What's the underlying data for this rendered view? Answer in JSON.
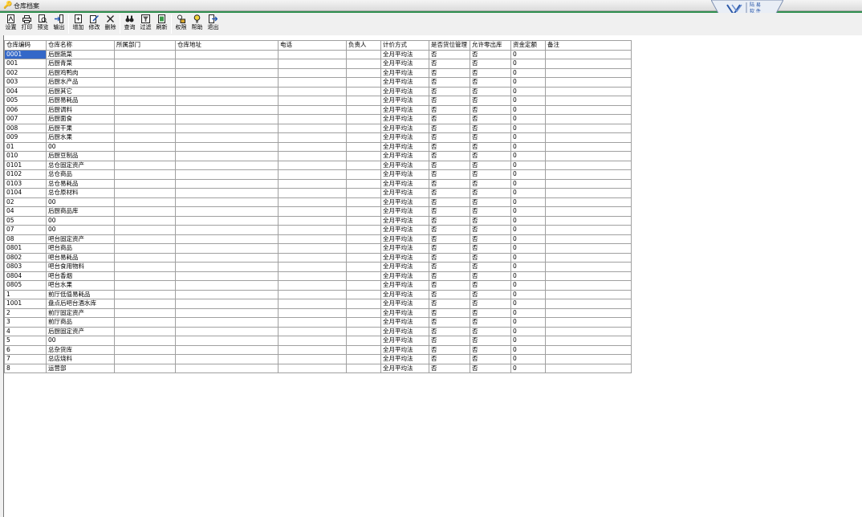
{
  "window": {
    "title": "仓库档案"
  },
  "logo": {
    "line1": "陆 易",
    "line2": "软 件"
  },
  "toolbar": [
    {
      "name": "settings",
      "label": "设置",
      "icon": "settings-icon"
    },
    {
      "name": "print",
      "label": "打印",
      "icon": "print-icon"
    },
    {
      "name": "preview",
      "label": "预览",
      "icon": "preview-icon"
    },
    {
      "name": "export",
      "label": "输出",
      "icon": "export-icon"
    },
    {
      "name": "add",
      "label": "增加",
      "icon": "add-icon"
    },
    {
      "name": "edit",
      "label": "修改",
      "icon": "edit-icon"
    },
    {
      "name": "delete",
      "label": "删除",
      "icon": "delete-icon"
    },
    {
      "name": "query",
      "label": "查询",
      "icon": "binoculars-icon"
    },
    {
      "name": "filter",
      "label": "过滤",
      "icon": "filter-icon"
    },
    {
      "name": "refresh",
      "label": "刷新",
      "icon": "refresh-icon"
    },
    {
      "name": "permission",
      "label": "权限",
      "icon": "permission-icon"
    },
    {
      "name": "help",
      "label": "帮助",
      "icon": "help-icon"
    },
    {
      "name": "exit",
      "label": "退出",
      "icon": "exit-icon"
    }
  ],
  "table": {
    "columns": [
      "仓库编码",
      "仓库名称",
      "所属部门",
      "仓库地址",
      "电话",
      "负责人",
      "计价方式",
      "是否货位管理",
      "允许零出库",
      "资金定额",
      "备注"
    ],
    "rows": [
      [
        "0001",
        "后厨蔬菜",
        "",
        "",
        "",
        "",
        "全月平均法",
        "否",
        "否",
        "0",
        ""
      ],
      [
        "001",
        "后厨青菜",
        "",
        "",
        "",
        "",
        "全月平均法",
        "否",
        "否",
        "0",
        ""
      ],
      [
        "002",
        "后厨鸡鸭肉",
        "",
        "",
        "",
        "",
        "全月平均法",
        "否",
        "否",
        "0",
        ""
      ],
      [
        "003",
        "后厨水产品",
        "",
        "",
        "",
        "",
        "全月平均法",
        "否",
        "否",
        "0",
        ""
      ],
      [
        "004",
        "后厨其它",
        "",
        "",
        "",
        "",
        "全月平均法",
        "否",
        "否",
        "0",
        ""
      ],
      [
        "005",
        "后厨易耗品",
        "",
        "",
        "",
        "",
        "全月平均法",
        "否",
        "否",
        "0",
        ""
      ],
      [
        "006",
        "后厨调料",
        "",
        "",
        "",
        "",
        "全月平均法",
        "否",
        "否",
        "0",
        ""
      ],
      [
        "007",
        "后厨面食",
        "",
        "",
        "",
        "",
        "全月平均法",
        "否",
        "否",
        "0",
        ""
      ],
      [
        "008",
        "后厨干果",
        "",
        "",
        "",
        "",
        "全月平均法",
        "否",
        "否",
        "0",
        ""
      ],
      [
        "009",
        "后厨水果",
        "",
        "",
        "",
        "",
        "全月平均法",
        "否",
        "否",
        "0",
        ""
      ],
      [
        "01",
        "00",
        "",
        "",
        "",
        "",
        "全月平均法",
        "否",
        "否",
        "0",
        ""
      ],
      [
        "010",
        "后厨豆制品",
        "",
        "",
        "",
        "",
        "全月平均法",
        "否",
        "否",
        "0",
        ""
      ],
      [
        "0101",
        "总仓固定资产",
        "",
        "",
        "",
        "",
        "全月平均法",
        "否",
        "否",
        "0",
        ""
      ],
      [
        "0102",
        "总仓商品",
        "",
        "",
        "",
        "",
        "全月平均法",
        "否",
        "否",
        "0",
        ""
      ],
      [
        "0103",
        "总仓易耗品",
        "",
        "",
        "",
        "",
        "全月平均法",
        "否",
        "否",
        "0",
        ""
      ],
      [
        "0104",
        "总仓原材料",
        "",
        "",
        "",
        "",
        "全月平均法",
        "否",
        "否",
        "0",
        ""
      ],
      [
        "02",
        "00",
        "",
        "",
        "",
        "",
        "全月平均法",
        "否",
        "否",
        "0",
        ""
      ],
      [
        "04",
        "后厨商品库",
        "",
        "",
        "",
        "",
        "全月平均法",
        "否",
        "否",
        "0",
        ""
      ],
      [
        "05",
        "00",
        "",
        "",
        "",
        "",
        "全月平均法",
        "否",
        "否",
        "0",
        ""
      ],
      [
        "07",
        "00",
        "",
        "",
        "",
        "",
        "全月平均法",
        "否",
        "否",
        "0",
        ""
      ],
      [
        "08",
        "吧台固定资产",
        "",
        "",
        "",
        "",
        "全月平均法",
        "否",
        "否",
        "0",
        ""
      ],
      [
        "0801",
        "吧台商品",
        "",
        "",
        "",
        "",
        "全月平均法",
        "否",
        "否",
        "0",
        ""
      ],
      [
        "0802",
        "吧台易耗品",
        "",
        "",
        "",
        "",
        "全月平均法",
        "否",
        "否",
        "0",
        ""
      ],
      [
        "0803",
        "吧台食用物料",
        "",
        "",
        "",
        "",
        "全月平均法",
        "否",
        "否",
        "0",
        ""
      ],
      [
        "0804",
        "吧台香烟",
        "",
        "",
        "",
        "",
        "全月平均法",
        "否",
        "否",
        "0",
        ""
      ],
      [
        "0805",
        "吧台水果",
        "",
        "",
        "",
        "",
        "全月平均法",
        "否",
        "否",
        "0",
        ""
      ],
      [
        "1",
        "前厅低值易耗品",
        "",
        "",
        "",
        "",
        "全月平均法",
        "否",
        "否",
        "0",
        ""
      ],
      [
        "1001",
        "盘点后吧台酒水库",
        "",
        "",
        "",
        "",
        "全月平均法",
        "否",
        "否",
        "0",
        ""
      ],
      [
        "2",
        "前厅固定资产",
        "",
        "",
        "",
        "",
        "全月平均法",
        "否",
        "否",
        "0",
        ""
      ],
      [
        "3",
        "前厅商品",
        "",
        "",
        "",
        "",
        "全月平均法",
        "否",
        "否",
        "0",
        ""
      ],
      [
        "4",
        "后厨固定资产",
        "",
        "",
        "",
        "",
        "全月平均法",
        "否",
        "否",
        "0",
        ""
      ],
      [
        "5",
        "00",
        "",
        "",
        "",
        "",
        "全月平均法",
        "否",
        "否",
        "0",
        ""
      ],
      [
        "6",
        "总杂货库",
        "",
        "",
        "",
        "",
        "全月平均法",
        "否",
        "否",
        "0",
        ""
      ],
      [
        "7",
        "总店烧料",
        "",
        "",
        "",
        "",
        "全月平均法",
        "否",
        "否",
        "0",
        ""
      ],
      [
        "8",
        "运营部",
        "",
        "",
        "",
        "",
        "全月平均法",
        "否",
        "否",
        "0",
        ""
      ]
    ]
  }
}
